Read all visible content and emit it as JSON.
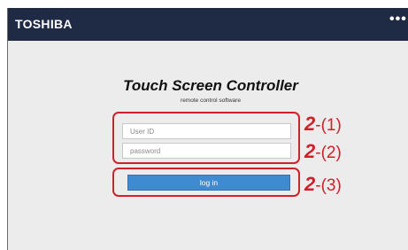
{
  "topbar": {
    "brand": "TOSHIBA",
    "menu_icon": "more-horizontal-icon",
    "colors": {
      "background": "#1f2a44",
      "text": "#ffffff"
    }
  },
  "login": {
    "title": "Touch Screen Controller",
    "subtitle": "remote control software",
    "user_id_placeholder": "User ID",
    "password_placeholder": "password",
    "button_label": "log in",
    "colors": {
      "button": "#3f8ad0",
      "page": "#ececec"
    }
  },
  "callouts": [
    {
      "number": "2",
      "suffix": "-(1)"
    },
    {
      "number": "2",
      "suffix": "-(2)"
    },
    {
      "number": "2",
      "suffix": "-(3)"
    }
  ],
  "annotation_color": "#d0202a"
}
